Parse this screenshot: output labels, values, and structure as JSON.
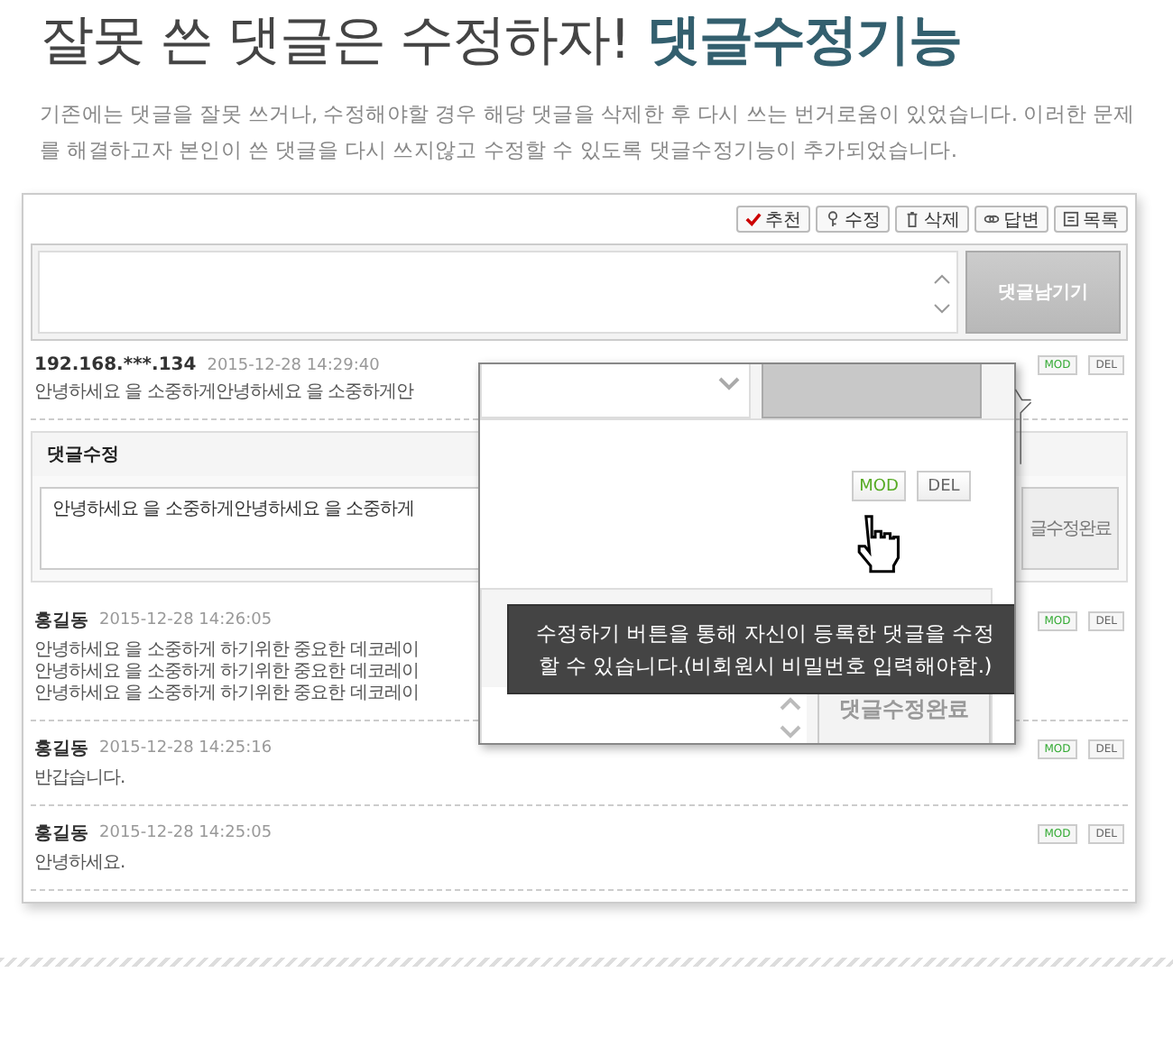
{
  "headline": {
    "text": "잘못 쓴 댓글은 수정하자!",
    "highlight": "댓글수정기능"
  },
  "intro": "기존에는 댓글을 잘못 쓰거나, 수정해야할 경우 해당 댓글을 삭제한 후 다시 쓰는 번거로움이 있었습니다. 이러한 문제를 해결하고자 본인이 쓴 댓글을 다시 쓰지않고 수정할 수 있도록 댓글수정기능이 추가되었습니다.",
  "board": {
    "toolbar": [
      "추천",
      "수정",
      "삭제",
      "답변",
      "목록"
    ],
    "comment_form": {
      "button": "댓글남기기"
    },
    "items": [
      {
        "kind": "comment",
        "author": "192.168.***.134",
        "date": "2015-12-28 14:29:40",
        "lines": [
          "안녕하세요 을 소중하게안녕하세요 을 소중하게안"
        ],
        "buttons": [
          "MOD",
          "DEL"
        ]
      },
      {
        "kind": "edit",
        "title": "댓글수정",
        "value": "안녕하세요 을 소중하게안녕하세요 을 소중하게",
        "button": "글수정완료"
      },
      {
        "kind": "comment",
        "author": "홍길동",
        "date": "2015-12-28 14:26:05",
        "lines": [
          "안녕하세요 을 소중하게 하기위한 중요한 데코레이",
          "안녕하세요 을 소중하게 하기위한 중요한 데코레이",
          "안녕하세요 을 소중하게 하기위한 중요한 데코레이"
        ],
        "buttons": [
          "MOD",
          "DEL"
        ]
      },
      {
        "kind": "comment",
        "author": "홍길동",
        "date": "2015-12-28 14:25:16",
        "lines": [
          "반갑습니다."
        ],
        "buttons": [
          "MOD",
          "DEL"
        ]
      },
      {
        "kind": "comment",
        "author": "홍길동",
        "date": "2015-12-28 14:25:05",
        "lines": [
          "안녕하세요."
        ],
        "buttons": [
          "MOD",
          "DEL"
        ]
      }
    ]
  },
  "zoom_callout": {
    "buttons": [
      "MOD",
      "DEL"
    ],
    "tooltip": "수정하기 버튼을 통해 자신이 등록한 댓글을 수정 할 수 있습니다.(비회원시 비밀번호 입력해야함.)",
    "button": "댓글수정완료"
  }
}
